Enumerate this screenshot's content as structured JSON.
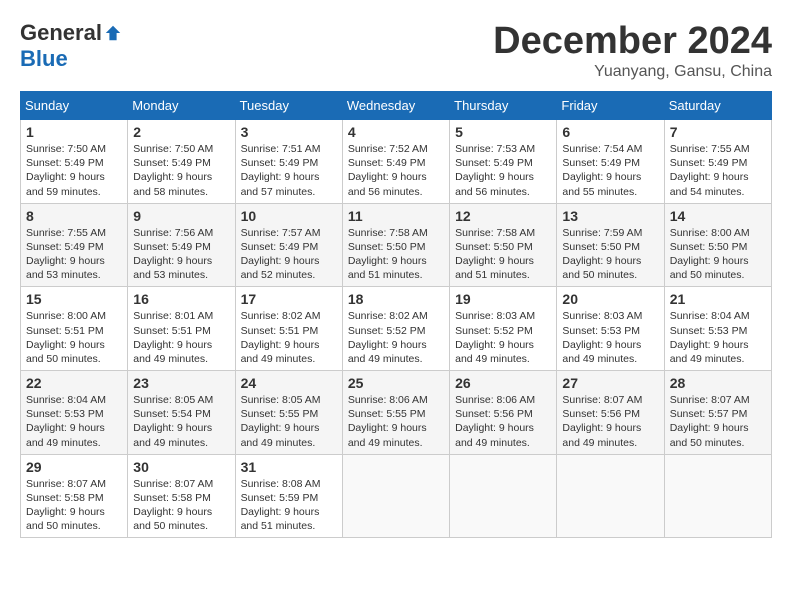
{
  "header": {
    "logo_general": "General",
    "logo_blue": "Blue",
    "title": "December 2024",
    "location": "Yuanyang, Gansu, China"
  },
  "weekdays": [
    "Sunday",
    "Monday",
    "Tuesday",
    "Wednesday",
    "Thursday",
    "Friday",
    "Saturday"
  ],
  "weeks": [
    [
      {
        "day": "1",
        "sunrise": "7:50 AM",
        "sunset": "5:49 PM",
        "daylight": "9 hours and 59 minutes."
      },
      {
        "day": "2",
        "sunrise": "7:50 AM",
        "sunset": "5:49 PM",
        "daylight": "9 hours and 58 minutes."
      },
      {
        "day": "3",
        "sunrise": "7:51 AM",
        "sunset": "5:49 PM",
        "daylight": "9 hours and 57 minutes."
      },
      {
        "day": "4",
        "sunrise": "7:52 AM",
        "sunset": "5:49 PM",
        "daylight": "9 hours and 56 minutes."
      },
      {
        "day": "5",
        "sunrise": "7:53 AM",
        "sunset": "5:49 PM",
        "daylight": "9 hours and 56 minutes."
      },
      {
        "day": "6",
        "sunrise": "7:54 AM",
        "sunset": "5:49 PM",
        "daylight": "9 hours and 55 minutes."
      },
      {
        "day": "7",
        "sunrise": "7:55 AM",
        "sunset": "5:49 PM",
        "daylight": "9 hours and 54 minutes."
      }
    ],
    [
      {
        "day": "8",
        "sunrise": "7:55 AM",
        "sunset": "5:49 PM",
        "daylight": "9 hours and 53 minutes."
      },
      {
        "day": "9",
        "sunrise": "7:56 AM",
        "sunset": "5:49 PM",
        "daylight": "9 hours and 53 minutes."
      },
      {
        "day": "10",
        "sunrise": "7:57 AM",
        "sunset": "5:49 PM",
        "daylight": "9 hours and 52 minutes."
      },
      {
        "day": "11",
        "sunrise": "7:58 AM",
        "sunset": "5:50 PM",
        "daylight": "9 hours and 51 minutes."
      },
      {
        "day": "12",
        "sunrise": "7:58 AM",
        "sunset": "5:50 PM",
        "daylight": "9 hours and 51 minutes."
      },
      {
        "day": "13",
        "sunrise": "7:59 AM",
        "sunset": "5:50 PM",
        "daylight": "9 hours and 50 minutes."
      },
      {
        "day": "14",
        "sunrise": "8:00 AM",
        "sunset": "5:50 PM",
        "daylight": "9 hours and 50 minutes."
      }
    ],
    [
      {
        "day": "15",
        "sunrise": "8:00 AM",
        "sunset": "5:51 PM",
        "daylight": "9 hours and 50 minutes."
      },
      {
        "day": "16",
        "sunrise": "8:01 AM",
        "sunset": "5:51 PM",
        "daylight": "9 hours and 49 minutes."
      },
      {
        "day": "17",
        "sunrise": "8:02 AM",
        "sunset": "5:51 PM",
        "daylight": "9 hours and 49 minutes."
      },
      {
        "day": "18",
        "sunrise": "8:02 AM",
        "sunset": "5:52 PM",
        "daylight": "9 hours and 49 minutes."
      },
      {
        "day": "19",
        "sunrise": "8:03 AM",
        "sunset": "5:52 PM",
        "daylight": "9 hours and 49 minutes."
      },
      {
        "day": "20",
        "sunrise": "8:03 AM",
        "sunset": "5:53 PM",
        "daylight": "9 hours and 49 minutes."
      },
      {
        "day": "21",
        "sunrise": "8:04 AM",
        "sunset": "5:53 PM",
        "daylight": "9 hours and 49 minutes."
      }
    ],
    [
      {
        "day": "22",
        "sunrise": "8:04 AM",
        "sunset": "5:53 PM",
        "daylight": "9 hours and 49 minutes."
      },
      {
        "day": "23",
        "sunrise": "8:05 AM",
        "sunset": "5:54 PM",
        "daylight": "9 hours and 49 minutes."
      },
      {
        "day": "24",
        "sunrise": "8:05 AM",
        "sunset": "5:55 PM",
        "daylight": "9 hours and 49 minutes."
      },
      {
        "day": "25",
        "sunrise": "8:06 AM",
        "sunset": "5:55 PM",
        "daylight": "9 hours and 49 minutes."
      },
      {
        "day": "26",
        "sunrise": "8:06 AM",
        "sunset": "5:56 PM",
        "daylight": "9 hours and 49 minutes."
      },
      {
        "day": "27",
        "sunrise": "8:07 AM",
        "sunset": "5:56 PM",
        "daylight": "9 hours and 49 minutes."
      },
      {
        "day": "28",
        "sunrise": "8:07 AM",
        "sunset": "5:57 PM",
        "daylight": "9 hours and 50 minutes."
      }
    ],
    [
      {
        "day": "29",
        "sunrise": "8:07 AM",
        "sunset": "5:58 PM",
        "daylight": "9 hours and 50 minutes."
      },
      {
        "day": "30",
        "sunrise": "8:07 AM",
        "sunset": "5:58 PM",
        "daylight": "9 hours and 50 minutes."
      },
      {
        "day": "31",
        "sunrise": "8:08 AM",
        "sunset": "5:59 PM",
        "daylight": "9 hours and 51 minutes."
      },
      null,
      null,
      null,
      null
    ]
  ]
}
